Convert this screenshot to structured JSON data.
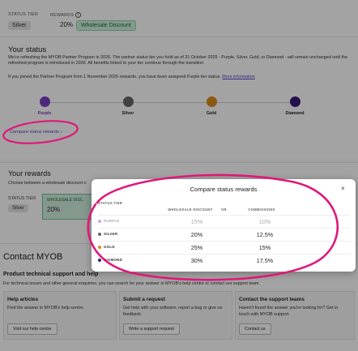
{
  "top": {
    "status_tier_label": "STATUS TIER",
    "status_tier_value": "Silver",
    "rewards_label": "REWARDS",
    "rewards_percent": "20%",
    "rewards_badge": "Wholesale Discount"
  },
  "status": {
    "heading": "Your status",
    "para1": "We're refreshing the MYOB Partner Program in 2026. The partner status tier you hold as of 31 October 2025 - Purple, Silver, Gold, or Diamond - will remain unchanged until the refreshed program is introduced in 2026. All benefits linked to your tier continue through the transition.",
    "para2": "If you joined the Partner Program from 1 November 2025 onwards, you have been assigned Purple tier status.",
    "more_info": "More information",
    "tiers": [
      {
        "name": "Purple",
        "color": "#7a3fc2"
      },
      {
        "name": "Silver",
        "color": "#666666"
      },
      {
        "name": "Gold",
        "color": "#d98a1a"
      },
      {
        "name": "Diamond",
        "color": "#3b1a7a"
      }
    ],
    "compare_link": "Compare status rewards"
  },
  "rewards": {
    "heading": "Your rewards",
    "sub": "Choose between a wholesale discount o",
    "status_tier_label": "STATUS TIER",
    "status_tier_value": "Silver",
    "card_title": "WHOLESALE DISC",
    "card_value": "20%"
  },
  "contact": {
    "heading": "Contact MYOB",
    "sub": "Product technical support and help",
    "desc": "For technical issues and other general enquiries, you can search for your answer in MYOB's help centre or contact our support team.",
    "cards": [
      {
        "title": "Help articles",
        "desc": "Find the answer in MYOB's help centre.",
        "button": "Visit our help centre"
      },
      {
        "title": "Submit a request",
        "desc": "Get help with your software, report a bug or give us feedback.",
        "button": "Write a support request"
      },
      {
        "title": "Contact the support teams",
        "desc": "Haven't found the answer you're looking for? Get in touch with MYOB support.",
        "button": "Contact us"
      }
    ]
  },
  "modal": {
    "title": "Compare status rewards",
    "close": "×",
    "col_tier": "STATUS TIER",
    "col_discount": "WHOLESALE DISCOUNT",
    "col_or": "OR",
    "col_commissions": "COMMISSIONS",
    "rows": [
      {
        "tier": "PURPLE",
        "color": "#c6a6ee",
        "discount": "15%",
        "commission": "10%"
      },
      {
        "tier": "SILVER",
        "color": "#666666",
        "discount": "20%",
        "commission": "12.5%"
      },
      {
        "tier": "GOLD",
        "color": "#d98a1a",
        "discount": "25%",
        "commission": "15%"
      },
      {
        "tier": "DIAMOND",
        "color": "#3b1a7a",
        "discount": "30%",
        "commission": "17.5%"
      }
    ]
  },
  "annotation_color": "#e0177a"
}
